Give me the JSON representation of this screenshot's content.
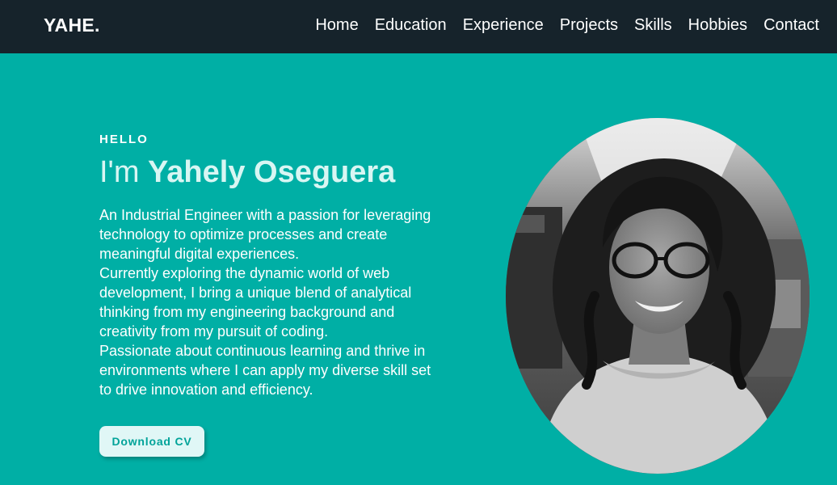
{
  "navbar": {
    "logo": "YAHE.",
    "links": [
      {
        "label": "Home"
      },
      {
        "label": "Education"
      },
      {
        "label": "Experience"
      },
      {
        "label": "Projects"
      },
      {
        "label": "Skills"
      },
      {
        "label": "Hobbies"
      },
      {
        "label": "Contact"
      }
    ]
  },
  "hero": {
    "eyebrow": "HELLO",
    "greeting": "I'm",
    "name": "Yahely Oseguera",
    "paragraphs": [
      "An Industrial Engineer with a passion for leveraging technology to optimize processes and create meaningful digital experiences.",
      "Currently exploring the dynamic world of web development, I bring a unique blend of analytical thinking from my engineering background and creativity from my pursuit of coding.",
      "Passionate about continuous learning and thrive in environments where I can apply my diverse skill set to drive innovation and efficiency."
    ],
    "cv_button": "Download CV"
  },
  "colors": {
    "navbar_bg": "#16232B",
    "hero_bg": "#00AFA5",
    "name_color": "#D8F6F3",
    "button_bg": "#E0F7F6",
    "button_text": "#00A399"
  }
}
